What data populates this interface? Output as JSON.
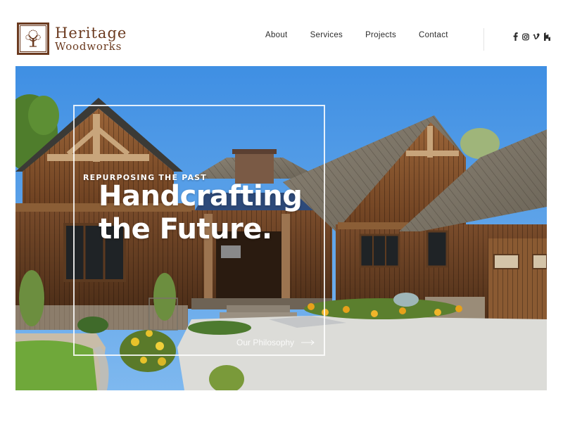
{
  "brand": {
    "line1": "Heritage",
    "line2": "Woodworks",
    "color": "#6b3a1f"
  },
  "nav": {
    "items": [
      {
        "label": "About"
      },
      {
        "label": "Services"
      },
      {
        "label": "Projects"
      },
      {
        "label": "Contact"
      }
    ]
  },
  "social": {
    "icons": [
      "facebook-icon",
      "instagram-icon",
      "vimeo-icon",
      "houzz-icon"
    ]
  },
  "hero": {
    "eyebrow": "REPURPOSING THE PAST",
    "headline_line1": "Handcrafting",
    "headline_line2": "the Future.",
    "cta_label": "Our Philosophy"
  }
}
